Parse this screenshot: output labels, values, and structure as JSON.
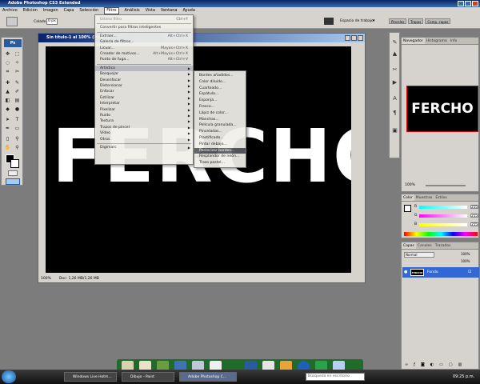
{
  "window": {
    "title": "Adobe Photoshop CS3 Extended"
  },
  "menubar": [
    "Archivo",
    "Edición",
    "Imagen",
    "Capa",
    "Selección",
    "Filtro",
    "Análisis",
    "Vista",
    "Ventana",
    "Ayuda"
  ],
  "menubar_active": "Filtro",
  "options": {
    "brush_label": "Calado:",
    "brush_value": "0 px",
    "workspace_label": "Espacio de trabajo",
    "workspace_arrow": "▾"
  },
  "top_tabs": [
    "Pinceles",
    "Trapos",
    "Comp. capas"
  ],
  "document": {
    "title": "Sin título-1 al 100% (RGB/8)",
    "text": "FERCHO",
    "zoom": "100%",
    "doc_info": "Doc: 1,26 MB/1,26 MB"
  },
  "filter_menu": {
    "items": [
      {
        "label": "Último filtro",
        "shortcut": "Ctrl+F",
        "disabled": true
      },
      {
        "sep": true
      },
      {
        "label": "Convertir para filtros inteligentes",
        "shortcut": ""
      },
      {
        "sep": true
      },
      {
        "label": "Extraer...",
        "shortcut": "Alt+Ctrl+X"
      },
      {
        "label": "Galería de filtros...",
        "shortcut": ""
      },
      {
        "label": "Licuar...",
        "shortcut": "Mayús+Ctrl+X"
      },
      {
        "label": "Creador de motivos...",
        "shortcut": "Alt+Mayús+Ctrl+X"
      },
      {
        "label": "Punto de fuga...",
        "shortcut": "Alt+Ctrl+V"
      },
      {
        "sep": true
      },
      {
        "label": "Artístico",
        "sub": true,
        "hl": true
      },
      {
        "label": "Bosquejar",
        "sub": true
      },
      {
        "label": "Desenfocar",
        "sub": true
      },
      {
        "label": "Distorsionar",
        "sub": true
      },
      {
        "label": "Enfocar",
        "sub": true
      },
      {
        "label": "Estilizar",
        "sub": true
      },
      {
        "label": "Interpretar",
        "sub": true
      },
      {
        "label": "Pixelizar",
        "sub": true
      },
      {
        "label": "Ruido",
        "sub": true
      },
      {
        "label": "Textura",
        "sub": true
      },
      {
        "label": "Trazos de pincel",
        "sub": true
      },
      {
        "label": "Vídeo",
        "sub": true
      },
      {
        "label": "Otros",
        "sub": true
      },
      {
        "sep": true
      },
      {
        "label": "Digimarc",
        "sub": true
      }
    ]
  },
  "artistic_submenu": [
    "Bordes añadidos...",
    "Color diluido...",
    "Cuarteado...",
    "Espátula...",
    "Esponja...",
    "Fresco...",
    "Lápiz de color...",
    "Manchas...",
    "Película granulada...",
    "Pinceladas...",
    "Plastificado...",
    "Pintar debajo...",
    "Posterizar bordes...",
    "Resplandor de neón...",
    "Trazo pastel..."
  ],
  "artistic_highlighted": "Posterizar bordes...",
  "navigator": {
    "tabs": [
      "Navegador",
      "Histograma",
      "Info"
    ],
    "thumb_text": "FERCHO",
    "zoom": "100%"
  },
  "color_panel": {
    "tabs": [
      "Color",
      "Muestras",
      "Estilos"
    ],
    "channels": [
      {
        "label": "R",
        "value": "255"
      },
      {
        "label": "G",
        "value": "255"
      },
      {
        "label": "B",
        "value": "255"
      }
    ]
  },
  "layers_panel": {
    "tabs": [
      "Capas",
      "Canales",
      "Trazados"
    ],
    "blend": "Normal",
    "opacity": "100%",
    "fill": "100%",
    "layer_name": "Fondo",
    "layer_thumb": "FERCHO"
  },
  "taskbar": {
    "items": [
      "Windows Live Hotm...",
      "Dibujo - Paint",
      "Adobe Photoshop C..."
    ],
    "active_index": 2,
    "search_placeholder": "Búsqueda en escritorio",
    "clock": "09:25 p.m."
  },
  "colors": {
    "accent": "#3168d5",
    "titlebar": "#0a246a",
    "panel": "#d6d3ce",
    "dock": "#1f6b2a"
  }
}
